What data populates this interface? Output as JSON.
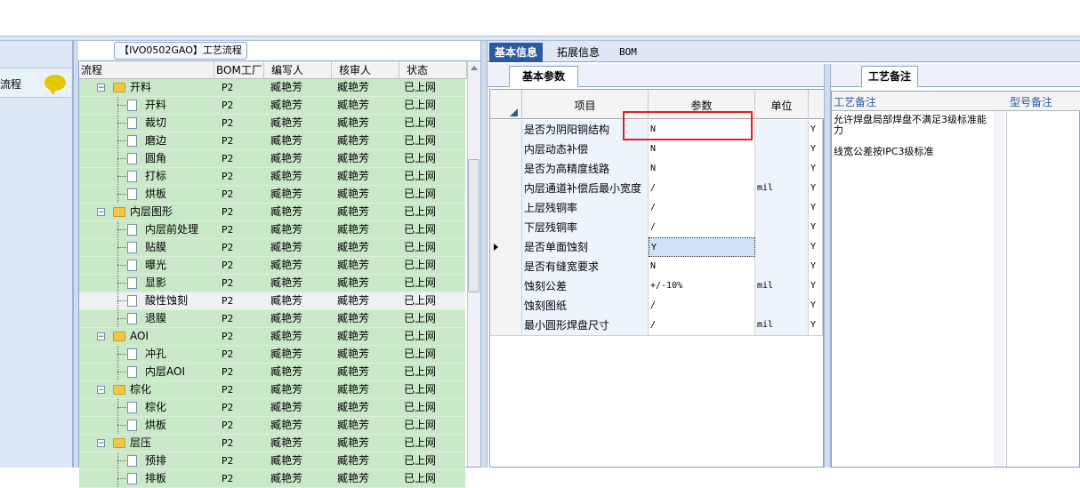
{
  "tree": {
    "title": "【IVO0502GAO】工艺流程",
    "columns": [
      "流程",
      "BOM工厂",
      "编写人",
      "核审人",
      "状态"
    ],
    "rows": [
      {
        "name": "开料",
        "level": 0,
        "type": "folder",
        "bom": "P2",
        "writer": "臧艳芳",
        "reviewer": "臧艳芳",
        "status": "已上网"
      },
      {
        "name": "开料",
        "level": 1,
        "type": "doc",
        "bom": "P2",
        "writer": "臧艳芳",
        "reviewer": "臧艳芳",
        "status": "已上网"
      },
      {
        "name": "裁切",
        "level": 1,
        "type": "doc",
        "bom": "P2",
        "writer": "臧艳芳",
        "reviewer": "臧艳芳",
        "status": "已上网"
      },
      {
        "name": "磨边",
        "level": 1,
        "type": "doc",
        "bom": "P2",
        "writer": "臧艳芳",
        "reviewer": "臧艳芳",
        "status": "已上网"
      },
      {
        "name": "圆角",
        "level": 1,
        "type": "doc",
        "bom": "P2",
        "writer": "臧艳芳",
        "reviewer": "臧艳芳",
        "status": "已上网"
      },
      {
        "name": "打标",
        "level": 1,
        "type": "doc",
        "bom": "P2",
        "writer": "臧艳芳",
        "reviewer": "臧艳芳",
        "status": "已上网"
      },
      {
        "name": "烘板",
        "level": 1,
        "type": "doc",
        "bom": "P2",
        "writer": "臧艳芳",
        "reviewer": "臧艳芳",
        "status": "已上网"
      },
      {
        "name": "内层图形",
        "level": 0,
        "type": "folder",
        "bom": "P2",
        "writer": "臧艳芳",
        "reviewer": "臧艳芳",
        "status": "已上网"
      },
      {
        "name": "内层前处理",
        "level": 1,
        "type": "doc",
        "bom": "P2",
        "writer": "臧艳芳",
        "reviewer": "臧艳芳",
        "status": "已上网"
      },
      {
        "name": "贴膜",
        "level": 1,
        "type": "doc",
        "bom": "P2",
        "writer": "臧艳芳",
        "reviewer": "臧艳芳",
        "status": "已上网"
      },
      {
        "name": "曝光",
        "level": 1,
        "type": "doc",
        "bom": "P2",
        "writer": "臧艳芳",
        "reviewer": "臧艳芳",
        "status": "已上网"
      },
      {
        "name": "显影",
        "level": 1,
        "type": "doc",
        "bom": "P2",
        "writer": "臧艳芳",
        "reviewer": "臧艳芳",
        "status": "已上网"
      },
      {
        "name": "酸性蚀刻",
        "level": 1,
        "type": "doc",
        "bom": "P2",
        "writer": "臧艳芳",
        "reviewer": "臧艳芳",
        "status": "已上网",
        "selected": true
      },
      {
        "name": "退膜",
        "level": 1,
        "type": "doc",
        "bom": "P2",
        "writer": "臧艳芳",
        "reviewer": "臧艳芳",
        "status": "已上网"
      },
      {
        "name": "AOI",
        "level": 0,
        "type": "folder",
        "bom": "P2",
        "writer": "臧艳芳",
        "reviewer": "臧艳芳",
        "status": "已上网"
      },
      {
        "name": "冲孔",
        "level": 1,
        "type": "doc",
        "bom": "P2",
        "writer": "臧艳芳",
        "reviewer": "臧艳芳",
        "status": "已上网"
      },
      {
        "name": "内层AOI",
        "level": 1,
        "type": "doc",
        "bom": "P2",
        "writer": "臧艳芳",
        "reviewer": "臧艳芳",
        "status": "已上网"
      },
      {
        "name": "棕化",
        "level": 0,
        "type": "folder",
        "bom": "P2",
        "writer": "臧艳芳",
        "reviewer": "臧艳芳",
        "status": "已上网"
      },
      {
        "name": "棕化",
        "level": 1,
        "type": "doc",
        "bom": "P2",
        "writer": "臧艳芳",
        "reviewer": "臧艳芳",
        "status": "已上网"
      },
      {
        "name": "烘板",
        "level": 1,
        "type": "doc",
        "bom": "P2",
        "writer": "臧艳芳",
        "reviewer": "臧艳芳",
        "status": "已上网"
      },
      {
        "name": "层压",
        "level": 0,
        "type": "folder",
        "bom": "P2",
        "writer": "臧艳芳",
        "reviewer": "臧艳芳",
        "status": "已上网"
      },
      {
        "name": "预排",
        "level": 1,
        "type": "doc",
        "bom": "P2",
        "writer": "臧艳芳",
        "reviewer": "臧艳芳",
        "status": "已上网"
      },
      {
        "name": "排板",
        "level": 1,
        "type": "doc",
        "bom": "P2",
        "writer": "臧艳芳",
        "reviewer": "臧艳芳",
        "status": "已上网"
      }
    ]
  },
  "leftnav": {
    "item_label": "流程"
  },
  "tabs": [
    "基本信息",
    "拓展信息",
    "BOM"
  ],
  "subtab": "基本参数",
  "params": {
    "columns": [
      "项目",
      "参数",
      "单位"
    ],
    "rows": [
      {
        "item": "是否为阴阳铜结构",
        "value": "N",
        "unit": "",
        "flag": "Y"
      },
      {
        "item": "内层动态补偿",
        "value": "N",
        "unit": "",
        "flag": "Y"
      },
      {
        "item": "是否为高精度线路",
        "value": "N",
        "unit": "",
        "flag": "Y"
      },
      {
        "item": "内层通道补偿后最小宽度",
        "value": "/",
        "unit": "mil",
        "flag": "Y"
      },
      {
        "item": "上层残铜率",
        "value": "/",
        "unit": "",
        "flag": "Y"
      },
      {
        "item": "下层残铜率",
        "value": "/",
        "unit": "",
        "flag": "Y"
      },
      {
        "item": "是否单面蚀刻",
        "value": "Y",
        "unit": "",
        "flag": "Y",
        "current": true
      },
      {
        "item": "是否有缝宽要求",
        "value": "N",
        "unit": "",
        "flag": "Y"
      },
      {
        "item": "蚀刻公差",
        "value": "+/-10%",
        "unit": "mil",
        "flag": "Y"
      },
      {
        "item": "蚀刻图纸",
        "value": "/",
        "unit": "",
        "flag": "Y"
      },
      {
        "item": "最小圆形焊盘尺寸",
        "value": "/",
        "unit": "mil",
        "flag": "Y"
      }
    ]
  },
  "notes": {
    "tab": "工艺备注",
    "columns": [
      "工艺备注",
      "型号备注"
    ],
    "lines": [
      "允许焊盘局部焊盘不满足3级标准能力",
      "线宽公差按IPC3级标准"
    ]
  }
}
